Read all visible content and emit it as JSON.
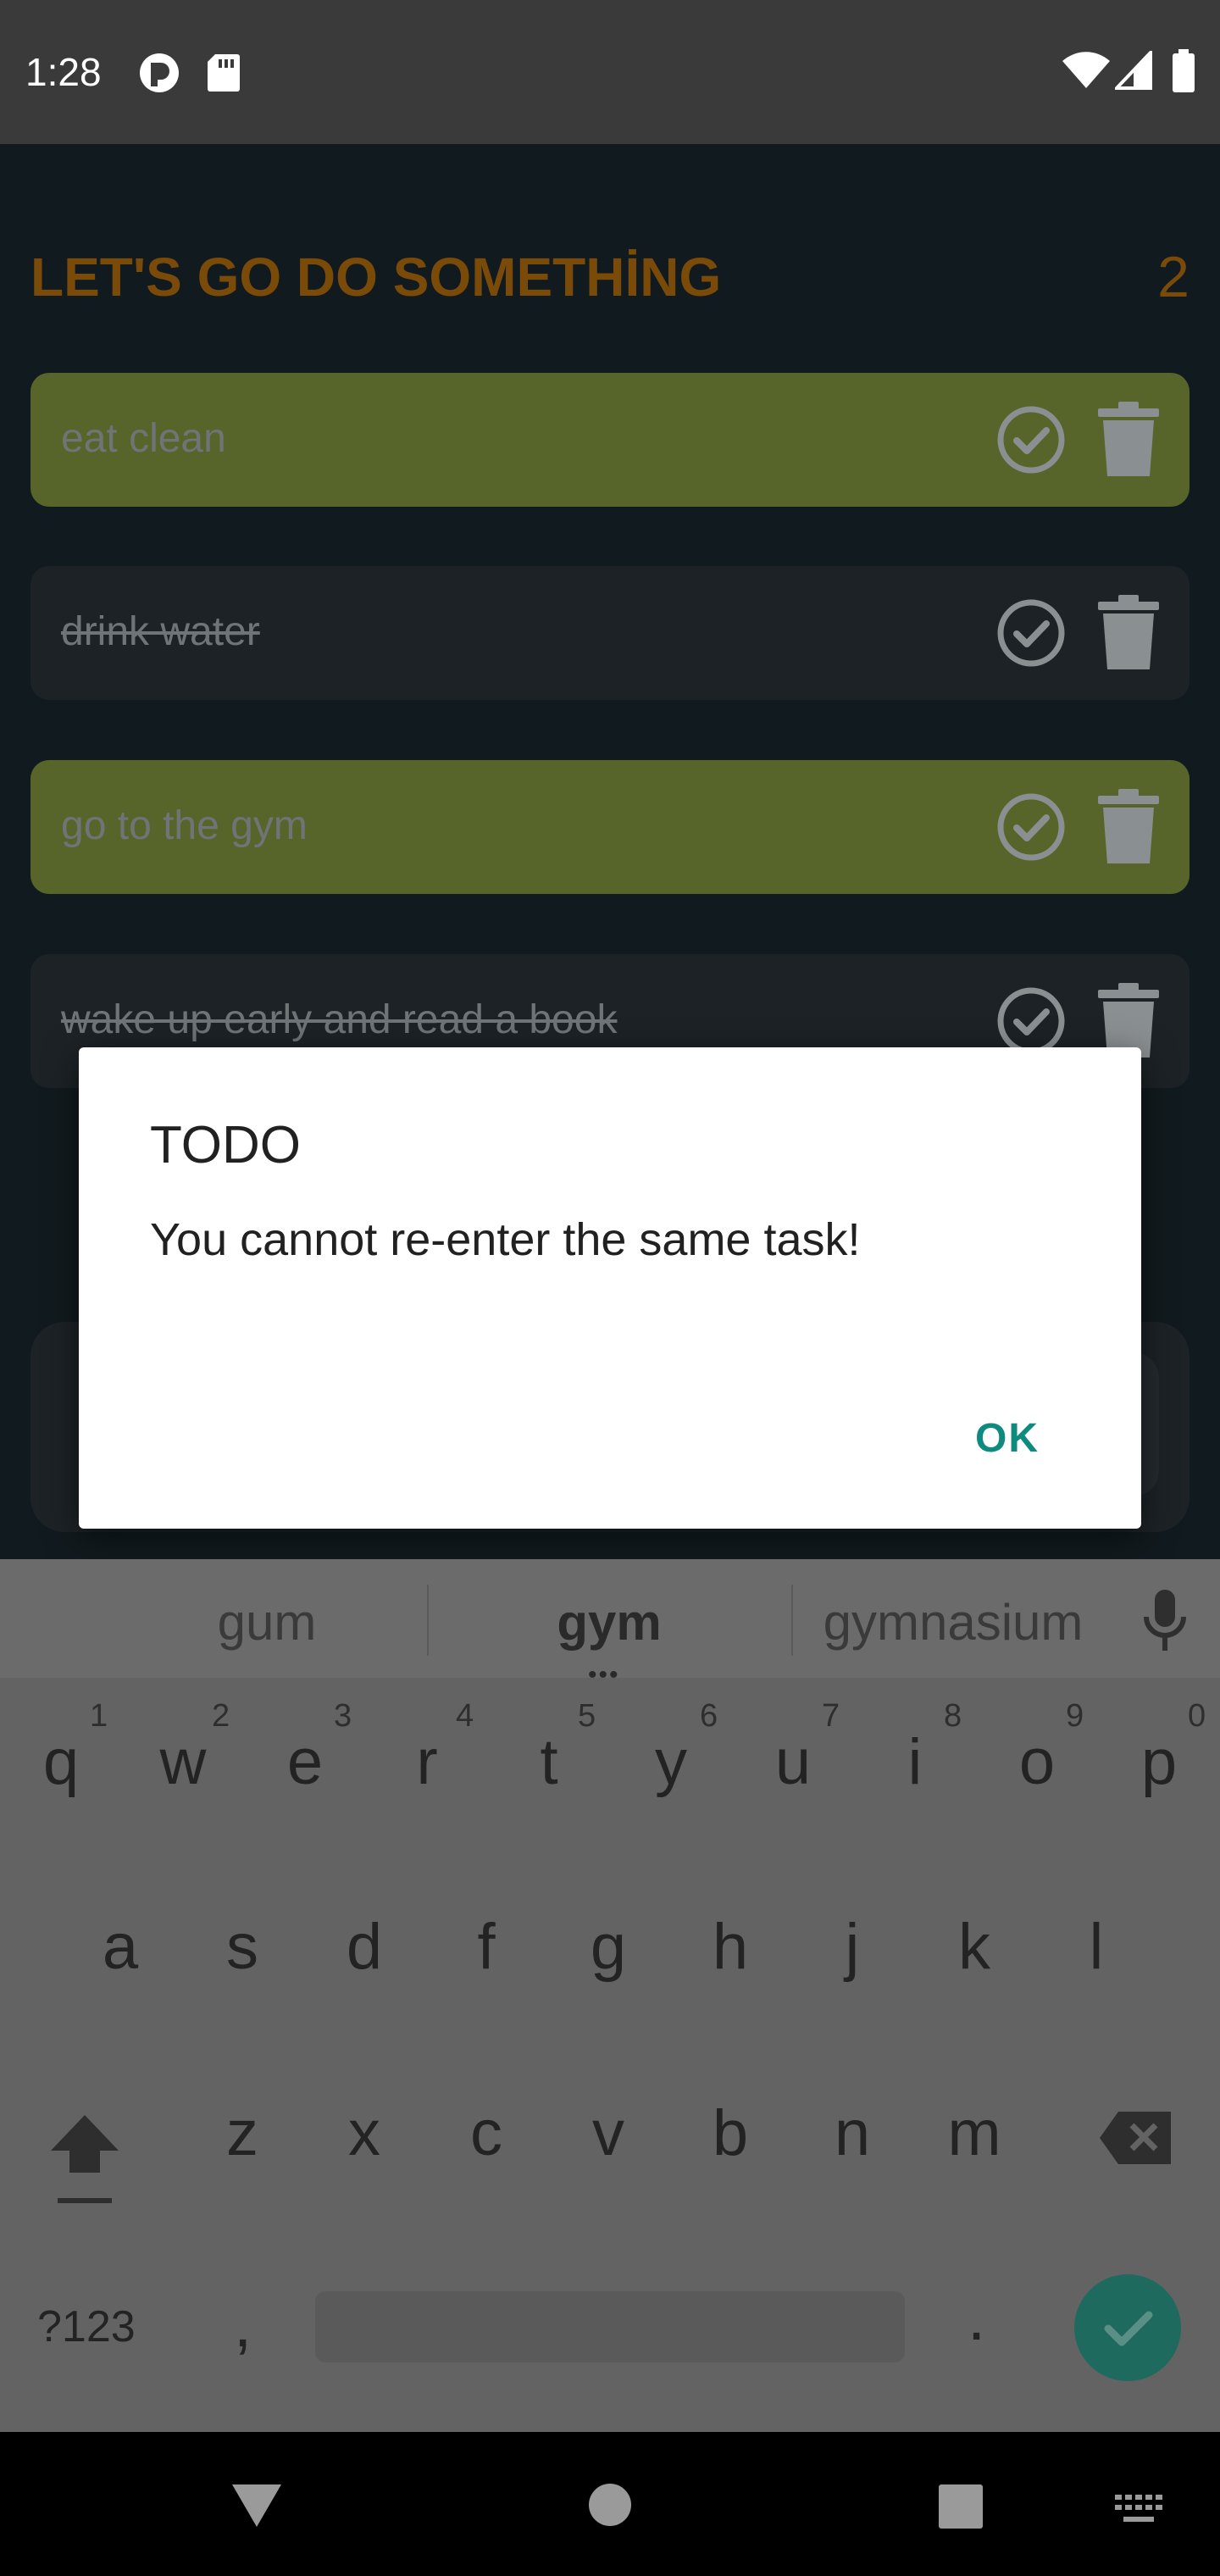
{
  "status_bar": {
    "time": "1:28"
  },
  "header": {
    "title": "LET'S GO DO SOMETHİNG",
    "count": "2"
  },
  "tasks": [
    {
      "text": "eat clean",
      "done": true
    },
    {
      "text": "drink water",
      "done": false
    },
    {
      "text": "go to the gym",
      "done": true
    },
    {
      "text": "wake up early and read a book",
      "done": false
    }
  ],
  "dialog": {
    "title": "TODO",
    "message": "You cannot re-enter the same task!",
    "ok_label": "OK"
  },
  "keyboard": {
    "suggestions": [
      "gum",
      "gym",
      "gymnasium"
    ],
    "row1": [
      "q",
      "w",
      "e",
      "r",
      "t",
      "y",
      "u",
      "i",
      "o",
      "p"
    ],
    "row1_hints": [
      "1",
      "2",
      "3",
      "4",
      "5",
      "6",
      "7",
      "8",
      "9",
      "0"
    ],
    "row2": [
      "a",
      "s",
      "d",
      "f",
      "g",
      "h",
      "j",
      "k",
      "l"
    ],
    "row3": [
      "z",
      "x",
      "c",
      "v",
      "b",
      "n",
      "m"
    ],
    "symbols_label": "?123",
    "comma": ",",
    "period": "."
  },
  "colors": {
    "accent": "#0f8a7e",
    "title": "#7a4a08",
    "done_task": "#57652a"
  }
}
